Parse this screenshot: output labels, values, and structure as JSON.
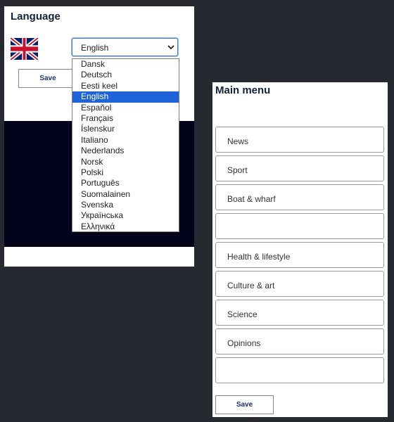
{
  "language_panel": {
    "title": "Language",
    "flag_icon": "uk-flag-icon",
    "select": {
      "value": "English",
      "chevron_icon": "chevron-down-icon"
    },
    "save_label": "Save",
    "dropdown": {
      "options": [
        "Dansk",
        "Deutsch",
        "Eesti keel",
        "English",
        "Español",
        "Français",
        "Íslenskur",
        "Italiano",
        "Nederlands",
        "Norsk",
        "Polski",
        "Português",
        "Suomalainen",
        "Svenska",
        "Українська",
        "Ελληνικά"
      ],
      "selected_index": 3
    }
  },
  "menu_panel": {
    "title": "Main menu",
    "items": [
      "News",
      "Sport",
      "Boat & wharf",
      "",
      "Health & lifestyle",
      "Culture & art",
      "Science",
      "Opinions",
      ""
    ],
    "save_label": "Save"
  },
  "colors": {
    "background": "#262a30",
    "dark_block": "#02031a",
    "selected_option": "#1e63d8",
    "title_text": "#13213b",
    "save_text": "#1b2e6e"
  }
}
